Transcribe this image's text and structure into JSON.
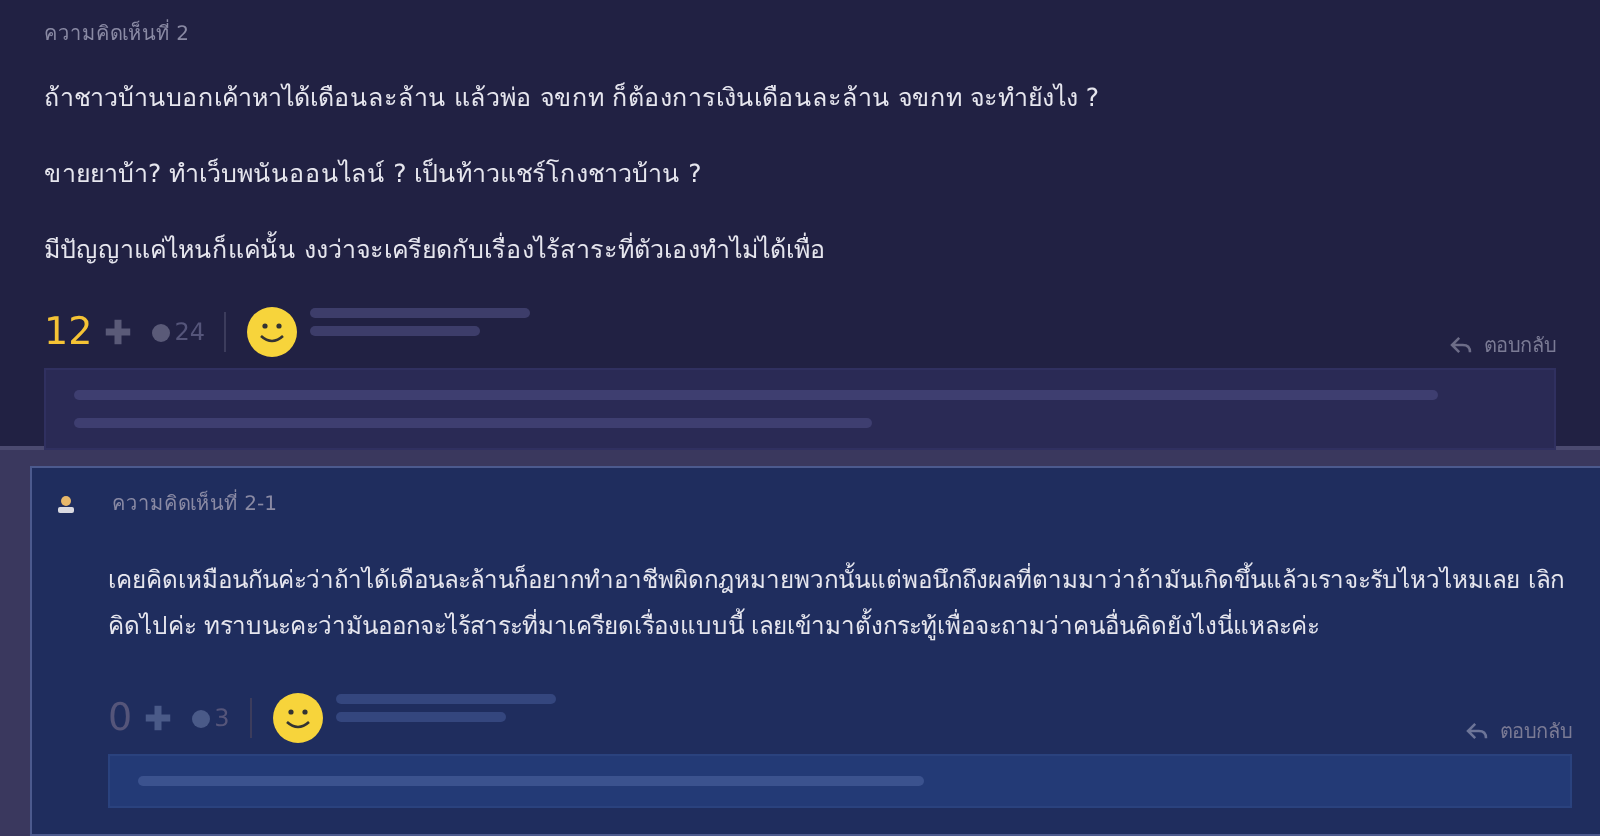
{
  "comments": [
    {
      "kind": "main",
      "label": "ความคิดเห็นที่ 2",
      "paragraphs": [
        "ถ้าชาวบ้านบอกเค้าหาได้เดือนละล้าน แล้วพ่อ จขกท ก็ต้องการเงินเดือนละล้าน จขกท จะทำยังไง ?",
        "ขายยาบ้า? ทำเว็บพนันออนไลน์ ? เป็นท้าวแชร์โกงชาวบ้าน ?",
        "มีปัญญาแค่ไหนก็แค่นั้น งงว่าจะเครียดกับเรื่องไร้สาระที่ตัวเองทำไม่ได้เพื่อ"
      ],
      "score": "12",
      "highlighted": true,
      "replies_count": "24",
      "reply_link": "ตอบกลับ"
    },
    {
      "kind": "reply",
      "label": "ความคิดเห็นที่ 2-1",
      "paragraphs": [
        "เคยคิดเหมือนกันค่ะว่าถ้าได้เดือนละล้านก็อยากทำอาชีพผิดกฎหมายพวกนั้นแต่พอนึกถึงผลที่ตามมาว่าถ้ามันเกิดขึ้นแล้วเราจะรับไหวไหมเลย เลิกคิดไปค่ะ ทราบนะคะว่ามันออกจะไร้สาระที่มาเครียดเรื่องแบบนี้ เลยเข้ามาตั้งกระทู้เพื่อจะถามว่าคนอื่นคิดยังไงนี่แหละค่ะ"
      ],
      "score": "0",
      "highlighted": false,
      "replies_count": "3",
      "reply_link": "ตอบกลับ"
    }
  ]
}
